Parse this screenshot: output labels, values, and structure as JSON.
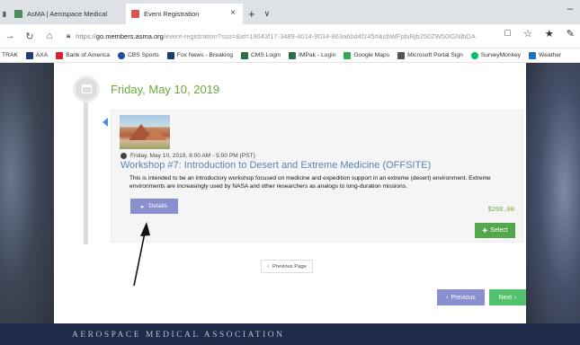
{
  "browser": {
    "tabs": [
      {
        "title": "AsMA | Aerospace Medical",
        "active": false,
        "favicon_color": "#4a8c5b"
      },
      {
        "title": "Event Registration",
        "active": true,
        "favicon_color": "#d9534f"
      }
    ],
    "new_tab": "+",
    "tab_dropdown": "∨",
    "minimize": "–",
    "close": "×",
    "nav": {
      "back": "→",
      "refresh": "↻",
      "home": "⌂"
    },
    "url": {
      "prefix": "https://",
      "host": "go.members.asma.org",
      "path": "/event-registration?sso=&id=19043f17-3489-4014-9034-863a6bd4f245#&sbWFpbiRjb250ZW50IGNlbDA"
    },
    "addr_icons": {
      "reading": "□",
      "favorite": "☆",
      "favorites_bar": "★",
      "pen": "✎"
    }
  },
  "favorites": [
    {
      "label": "TRAK",
      "icon_color": ""
    },
    {
      "label": "AXA",
      "icon_color": "#1f3d7a"
    },
    {
      "label": "Bank of America",
      "icon_color": "#d8232a"
    },
    {
      "label": "CBS Sports",
      "icon_color": "#1b4f9c"
    },
    {
      "label": "Fox News - Breaking",
      "icon_color": "#1a3c6e"
    },
    {
      "label": "CMS Login",
      "icon_color": "#2c6e49"
    },
    {
      "label": "IMPak - Login",
      "icon_color": "#2c6e49"
    },
    {
      "label": "Google Maps",
      "icon_color": "#34a853"
    },
    {
      "label": "Microsoft Portal Sign",
      "icon_color": "#555555"
    },
    {
      "label": "SurveyMonkey",
      "icon_color": "#00bf6f"
    },
    {
      "label": "Weather",
      "icon_color": "#1e73be"
    }
  ],
  "event": {
    "date_heading": "Friday, May 10, 2019",
    "time": "Friday, May 10, 2019, 8:00 AM - 5:00 PM (PST)",
    "title": "Workshop #7: Introduction to Desert and Extreme Medicine (OFFSITE)",
    "description": "This is intended to be an introductory workshop focused on medicine and expedition support in an extreme (desert) environment. Extreme environments are increasingly used by NASA and other researchers as analogs to long-duration missions.",
    "details_label": "Details",
    "price": "$200.00",
    "select_label": "Select"
  },
  "pagination": {
    "previous_page": "Previous Page",
    "previous": "Previous",
    "next": "Next"
  },
  "footer": {
    "title": "AEROSPACE MEDICAL ASSOCIATION"
  },
  "colors": {
    "accent_green": "#6aaa3a",
    "title_blue": "#5b83b8",
    "button_purple": "#8a8fd0",
    "button_green": "#53a84d"
  }
}
